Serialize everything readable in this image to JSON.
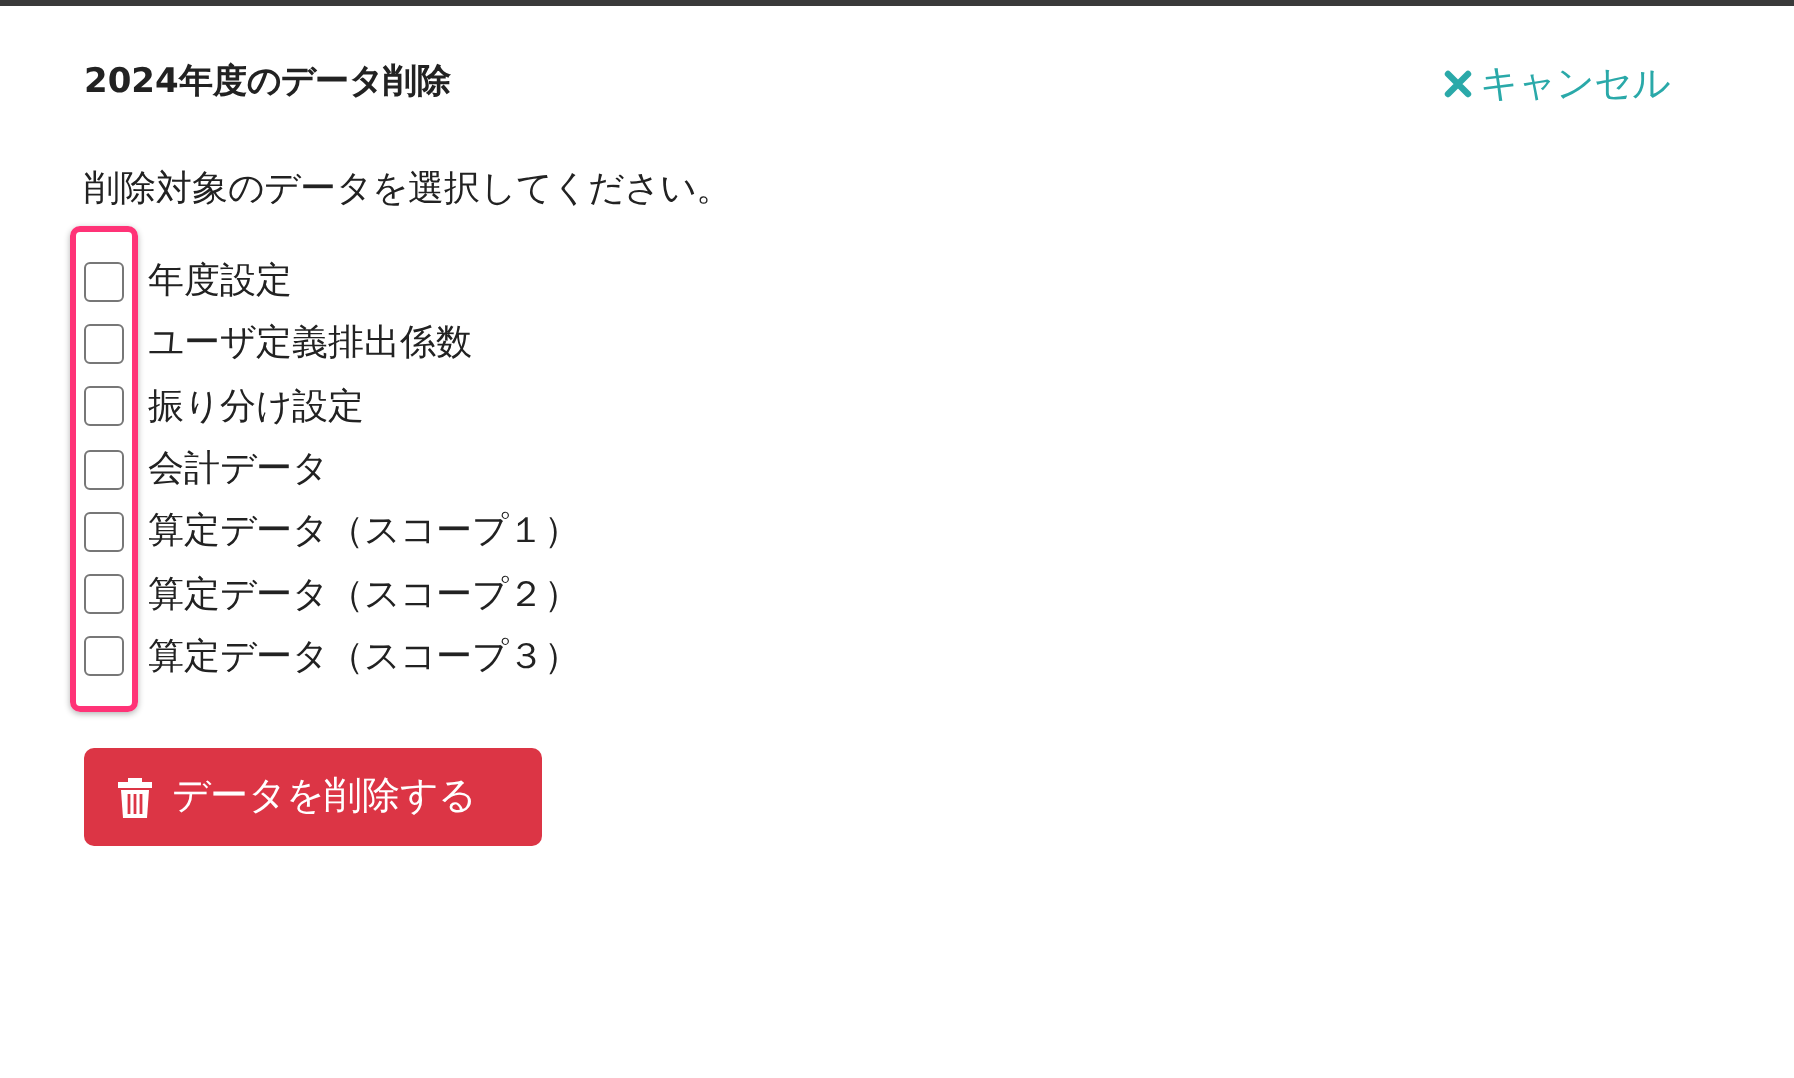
{
  "title": "2024年度のデータ削除",
  "cancel": {
    "label": "キャンセル"
  },
  "instruction": "削除対象のデータを選択してください。",
  "options": [
    {
      "label": "年度設定",
      "checked": false
    },
    {
      "label": "ユーザ定義排出係数",
      "checked": false
    },
    {
      "label": "振り分け設定",
      "checked": false
    },
    {
      "label": "会計データ",
      "checked": false
    },
    {
      "label": "算定データ（スコープ１）",
      "checked": false
    },
    {
      "label": "算定データ（スコープ２）",
      "checked": false
    },
    {
      "label": "算定データ（スコープ３）",
      "checked": false
    }
  ],
  "delete_button": {
    "label": "データを削除する"
  }
}
